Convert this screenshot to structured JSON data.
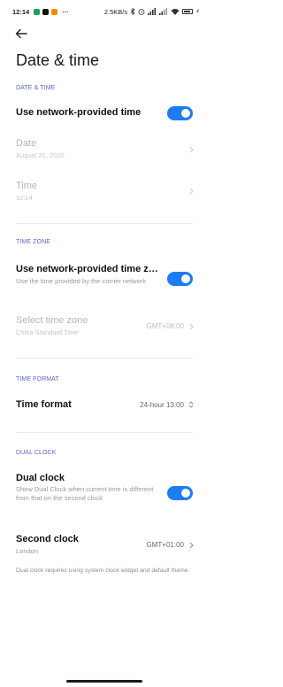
{
  "status": {
    "time": "12:14",
    "network_speed": "2.5KB/s",
    "battery": "⚡",
    "more": "···"
  },
  "page": {
    "title": "Date & time"
  },
  "sections": {
    "date_time": "DATE & TIME",
    "time_zone": "TIME ZONE",
    "time_format": "TIME FORMAT",
    "dual_clock": "DUAL CLOCK"
  },
  "rows": {
    "network_time": {
      "title": "Use network-provided time",
      "toggle": true
    },
    "date": {
      "title": "Date",
      "subtitle": "August 21, 2020"
    },
    "time": {
      "title": "Time",
      "subtitle": "12:14"
    },
    "network_time_zone": {
      "title": "Use network-provided time z…",
      "subtitle": "Use the time provided by the carrier network",
      "toggle": true
    },
    "select_time_zone": {
      "title": "Select time zone",
      "subtitle": "China Standard Time",
      "value": "GMT+08:00"
    },
    "time_format": {
      "title": "Time format",
      "value": "24-hour 13:00"
    },
    "dual_clock": {
      "title": "Dual clock",
      "subtitle": "Show Dual Clock when current time is different from that on the second clock",
      "toggle": true
    },
    "second_clock": {
      "title": "Second clock",
      "subtitle": "London",
      "value": "GMT+01:00"
    }
  },
  "footer_note": "Dual clock requires using system clock widget and default theme",
  "colors": {
    "accent": "#1e7bf2",
    "section_header": "#5867c9"
  }
}
